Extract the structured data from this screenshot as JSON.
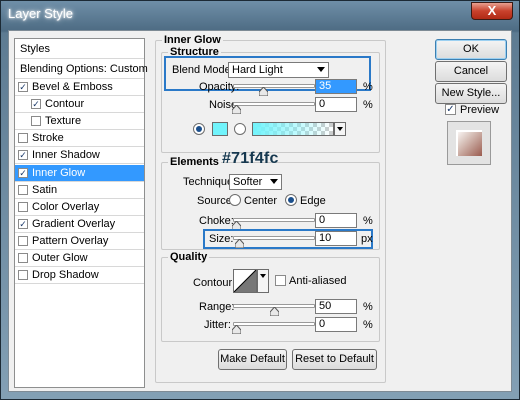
{
  "window": {
    "title": "Layer Style",
    "close_glyph": "X"
  },
  "sidebar": {
    "header": "Styles",
    "blending": "Blending Options: Custom",
    "items": [
      {
        "label": "Bevel & Emboss",
        "checked": true,
        "indent": false
      },
      {
        "label": "Contour",
        "checked": true,
        "indent": true
      },
      {
        "label": "Texture",
        "checked": false,
        "indent": true
      },
      {
        "label": "Stroke",
        "checked": false,
        "indent": false
      },
      {
        "label": "Inner Shadow",
        "checked": true,
        "indent": false
      },
      {
        "label": "Inner Glow",
        "checked": true,
        "indent": false,
        "selected": true
      },
      {
        "label": "Satin",
        "checked": false,
        "indent": false
      },
      {
        "label": "Color Overlay",
        "checked": false,
        "indent": false
      },
      {
        "label": "Gradient Overlay",
        "checked": true,
        "indent": false
      },
      {
        "label": "Pattern Overlay",
        "checked": false,
        "indent": false
      },
      {
        "label": "Outer Glow",
        "checked": false,
        "indent": false
      },
      {
        "label": "Drop Shadow",
        "checked": false,
        "indent": false
      }
    ],
    "check_glyph": "✓"
  },
  "panel": {
    "title": "Inner Glow",
    "structure": {
      "legend": "Structure",
      "blend_mode_label": "Blend Mode:",
      "blend_mode_value": "Hard Light",
      "opacity_label": "Opacity:",
      "opacity_value": "35",
      "opacity_unit": "%",
      "opacity_fraction": 0.35,
      "noise_label": "Noise:",
      "noise_value": "0",
      "noise_unit": "%",
      "noise_fraction": 0.0,
      "color_hex": "#71f4fc"
    },
    "elements": {
      "legend": "Elements",
      "color_annotation": "#71f4fc",
      "technique_label": "Technique:",
      "technique_value": "Softer",
      "source_label": "Source:",
      "source_center": "Center",
      "source_edge": "Edge",
      "choke_label": "Choke:",
      "choke_value": "0",
      "choke_unit": "%",
      "choke_fraction": 0.0,
      "size_label": "Size:",
      "size_value": "10",
      "size_unit": "px",
      "size_fraction": 0.04
    },
    "quality": {
      "legend": "Quality",
      "contour_label": "Contour:",
      "anti_aliased_label": "Anti-aliased",
      "range_label": "Range:",
      "range_value": "50",
      "range_unit": "%",
      "range_fraction": 0.5,
      "jitter_label": "Jitter:",
      "jitter_value": "0",
      "jitter_unit": "%",
      "jitter_fraction": 0.0
    },
    "make_default": "Make Default",
    "reset_default": "Reset to Default"
  },
  "actions": {
    "ok": "OK",
    "cancel": "Cancel",
    "new_style": "New Style...",
    "preview_label": "Preview",
    "preview_checked": true
  },
  "colors": {
    "accent": "#3399ff",
    "highlight_border": "#2a79c8",
    "glow": "#71f4fc"
  }
}
